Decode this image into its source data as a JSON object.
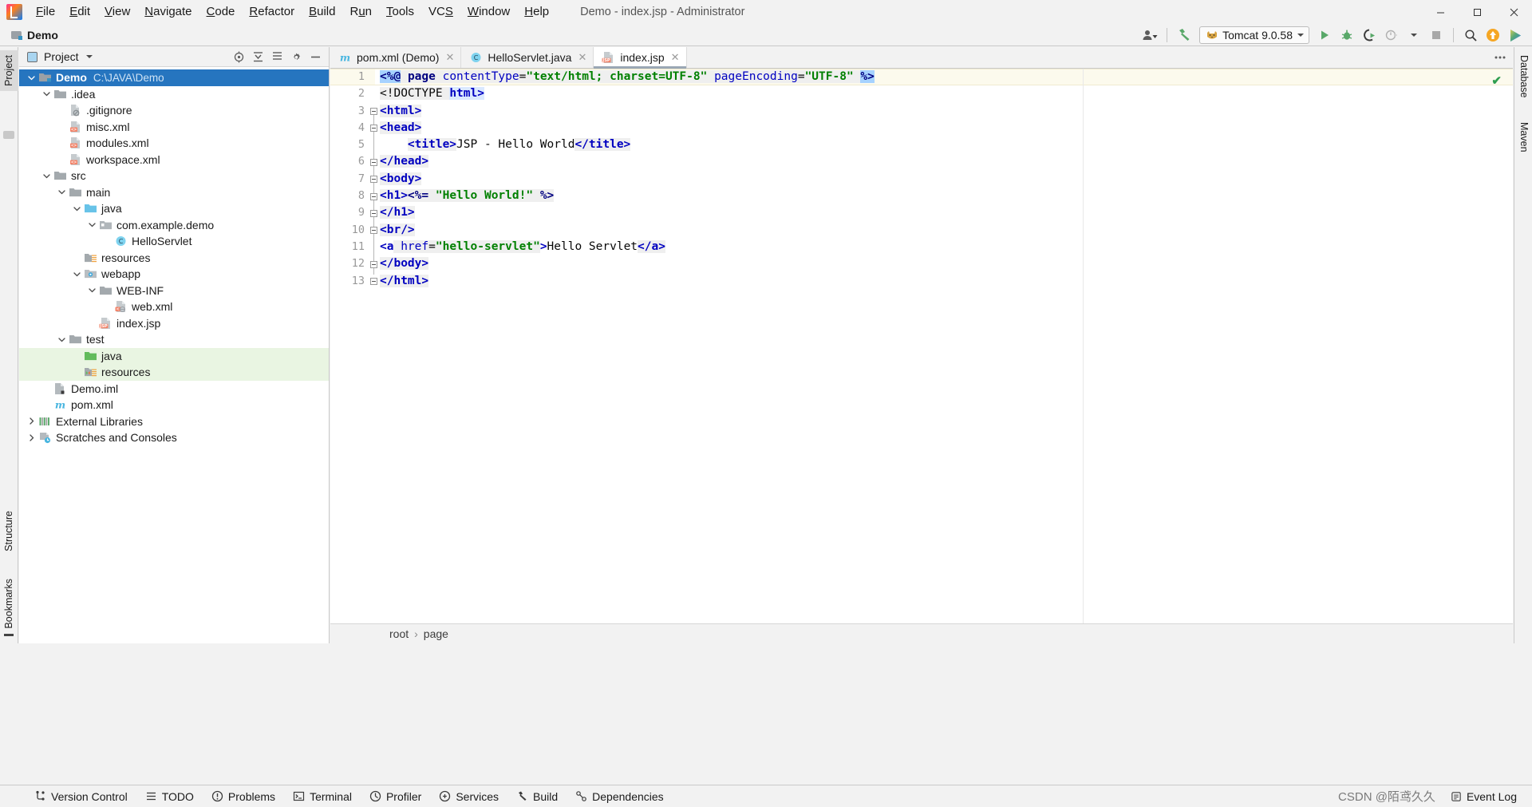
{
  "window": {
    "title": "Demo - index.jsp - Administrator",
    "app_icon": "intellij-idea-logo",
    "controls": {
      "minimize": "─",
      "maximize": "☐",
      "close": "✕"
    }
  },
  "menu": {
    "items": [
      {
        "label": "File",
        "mnemonic": "F"
      },
      {
        "label": "Edit",
        "mnemonic": "E"
      },
      {
        "label": "View",
        "mnemonic": "V"
      },
      {
        "label": "Navigate",
        "mnemonic": "N"
      },
      {
        "label": "Code",
        "mnemonic": "C"
      },
      {
        "label": "Refactor",
        "mnemonic": "R"
      },
      {
        "label": "Build",
        "mnemonic": "B"
      },
      {
        "label": "Run",
        "mnemonic": "u"
      },
      {
        "label": "Tools",
        "mnemonic": "T"
      },
      {
        "label": "VCS",
        "mnemonic": "S"
      },
      {
        "label": "Window",
        "mnemonic": "W"
      },
      {
        "label": "Help",
        "mnemonic": "H"
      }
    ]
  },
  "toolbar": {
    "breadcrumb_project": "Demo",
    "run_config": "Tomcat 9.0.58",
    "run_config_icon": "tomcat-cat-icon",
    "icons": {
      "user": "user-silhouette-icon",
      "hammer": "build-hammer-icon",
      "run": "run-play-icon",
      "debug": "debug-bug-icon",
      "run_coverage": "run-with-coverage-icon",
      "profile": "profiler-icon",
      "stop": "stop-square-icon",
      "search": "search-magnifier-icon",
      "updates": "update-arrow-icon",
      "ide_feature": "ide-feature-trainer-icon"
    }
  },
  "left_strip": {
    "tabs": [
      {
        "label": "Project",
        "active": true
      },
      {
        "label": "Structure",
        "active": false
      },
      {
        "label": "Bookmarks",
        "active": false
      }
    ]
  },
  "right_strip": {
    "tabs": [
      {
        "label": "Database",
        "active": false
      },
      {
        "label": "Maven",
        "active": false
      }
    ]
  },
  "project_panel": {
    "title": "Project",
    "header_icons": [
      "locate-icon",
      "collapse-all-icon",
      "expand-all-icon",
      "settings-gear-icon",
      "hide-minus-icon"
    ],
    "tree": [
      {
        "label": "Demo",
        "path": "C:\\JAVA\\Demo",
        "indent": 0,
        "arrow": "down",
        "icon": "module-folder-icon",
        "state": "selected",
        "bold": true
      },
      {
        "label": ".idea",
        "path": "",
        "indent": 1,
        "arrow": "down",
        "icon": "folder-icon",
        "state": "normal"
      },
      {
        "label": ".gitignore",
        "path": "",
        "indent": 2,
        "arrow": "none",
        "icon": "gitignore-file-icon",
        "state": "normal"
      },
      {
        "label": "misc.xml",
        "path": "",
        "indent": 2,
        "arrow": "none",
        "icon": "xml-file-icon",
        "state": "normal"
      },
      {
        "label": "modules.xml",
        "path": "",
        "indent": 2,
        "arrow": "none",
        "icon": "xml-file-icon",
        "state": "normal"
      },
      {
        "label": "workspace.xml",
        "path": "",
        "indent": 2,
        "arrow": "none",
        "icon": "xml-file-icon",
        "state": "normal"
      },
      {
        "label": "src",
        "path": "",
        "indent": 1,
        "arrow": "down",
        "icon": "folder-icon",
        "state": "normal"
      },
      {
        "label": "main",
        "path": "",
        "indent": 2,
        "arrow": "down",
        "icon": "folder-icon",
        "state": "normal"
      },
      {
        "label": "java",
        "path": "",
        "indent": 3,
        "arrow": "down",
        "icon": "source-root-icon",
        "state": "normal"
      },
      {
        "label": "com.example.demo",
        "path": "",
        "indent": 4,
        "arrow": "down",
        "icon": "package-icon",
        "state": "normal"
      },
      {
        "label": "HelloServlet",
        "path": "",
        "indent": 5,
        "arrow": "none",
        "icon": "java-class-icon",
        "state": "normal"
      },
      {
        "label": "resources",
        "path": "",
        "indent": 3,
        "arrow": "none",
        "icon": "resource-root-icon",
        "state": "normal"
      },
      {
        "label": "webapp",
        "path": "",
        "indent": 3,
        "arrow": "down",
        "icon": "web-root-icon",
        "state": "normal"
      },
      {
        "label": "WEB-INF",
        "path": "",
        "indent": 4,
        "arrow": "down",
        "icon": "folder-icon",
        "state": "normal"
      },
      {
        "label": "web.xml",
        "path": "",
        "indent": 5,
        "arrow": "none",
        "icon": "web-xml-file-icon",
        "state": "normal"
      },
      {
        "label": "index.jsp",
        "path": "",
        "indent": 4,
        "arrow": "none",
        "icon": "jsp-file-icon",
        "state": "normal"
      },
      {
        "label": "test",
        "path": "",
        "indent": 2,
        "arrow": "down",
        "icon": "folder-icon",
        "state": "normal"
      },
      {
        "label": "java",
        "path": "",
        "indent": 3,
        "arrow": "none",
        "icon": "test-source-root-icon",
        "state": "green"
      },
      {
        "label": "resources",
        "path": "",
        "indent": 3,
        "arrow": "none",
        "icon": "test-resource-root-icon",
        "state": "green"
      },
      {
        "label": "Demo.iml",
        "path": "",
        "indent": 1,
        "arrow": "none",
        "icon": "iml-file-icon",
        "state": "normal"
      },
      {
        "label": "pom.xml",
        "path": "",
        "indent": 1,
        "arrow": "none",
        "icon": "maven-pom-icon",
        "state": "normal"
      },
      {
        "label": "External Libraries",
        "path": "",
        "indent": 0,
        "arrow": "right",
        "icon": "libraries-icon",
        "state": "normal"
      },
      {
        "label": "Scratches and Consoles",
        "path": "",
        "indent": 0,
        "arrow": "right",
        "icon": "scratches-icon",
        "state": "normal"
      }
    ]
  },
  "editor": {
    "tabs": [
      {
        "label": "pom.xml (Demo)",
        "icon": "maven-pom-icon",
        "active": false,
        "close": "✕"
      },
      {
        "label": "HelloServlet.java",
        "icon": "java-class-icon",
        "active": false,
        "close": "✕"
      },
      {
        "label": "index.jsp",
        "icon": "jsp-file-icon",
        "active": true,
        "close": "✕"
      }
    ],
    "inspection_status": "✔",
    "gear_icon": "editor-settings-gear-icon",
    "line_numbers": [
      "1",
      "2",
      "3",
      "4",
      "5",
      "6",
      "7",
      "8",
      "9",
      "10",
      "11",
      "12",
      "13"
    ],
    "current_line": 1,
    "lines": [
      {
        "n": 1,
        "parts": [
          {
            "t": "<%@",
            "c": "sel"
          },
          {
            "t": " ",
            "c": "soft"
          },
          {
            "t": "page",
            "c": "kw"
          },
          {
            "t": " ",
            "c": "soft"
          },
          {
            "t": "contentType",
            "c": "attr"
          },
          {
            "t": "=",
            "c": "soft"
          },
          {
            "t": "\"text/html; charset=UTF-8\"",
            "c": "str"
          },
          {
            "t": " ",
            "c": "soft"
          },
          {
            "t": "pageEncoding",
            "c": "attr"
          },
          {
            "t": "=",
            "c": "soft"
          },
          {
            "t": "\"UTF-8\"",
            "c": "str"
          },
          {
            "t": " ",
            "c": "soft"
          },
          {
            "t": "%>",
            "c": "sel"
          }
        ]
      },
      {
        "n": 2,
        "parts": [
          {
            "t": "<!DOCTYPE",
            "c": "doctype"
          },
          {
            "t": " ",
            "c": "soft"
          },
          {
            "t": "html>",
            "c": "htmlkw"
          }
        ]
      },
      {
        "n": 3,
        "parts": [
          {
            "t": "<html>",
            "c": "tagsoft"
          }
        ]
      },
      {
        "n": 4,
        "parts": [
          {
            "t": "<head>",
            "c": "tagsoft"
          }
        ]
      },
      {
        "n": 5,
        "parts": [
          {
            "t": "    ",
            "c": "plain"
          },
          {
            "t": "<title>",
            "c": "tagsoft"
          },
          {
            "t": "JSP - Hello World",
            "c": "plain"
          },
          {
            "t": "</title>",
            "c": "tagsoft"
          }
        ]
      },
      {
        "n": 6,
        "parts": [
          {
            "t": "</head>",
            "c": "tagsoft"
          }
        ]
      },
      {
        "n": 7,
        "parts": [
          {
            "t": "<body>",
            "c": "tagsoft"
          }
        ]
      },
      {
        "n": 8,
        "parts": [
          {
            "t": "<h1>",
            "c": "tagsoft"
          },
          {
            "t": "<%=",
            "c": "kwsoft"
          },
          {
            "t": " ",
            "c": "soft"
          },
          {
            "t": "\"Hello World!\"",
            "c": "str"
          },
          {
            "t": " ",
            "c": "soft"
          },
          {
            "t": "%>",
            "c": "kwsoft"
          }
        ]
      },
      {
        "n": 9,
        "parts": [
          {
            "t": "</h1>",
            "c": "tagsoft"
          }
        ]
      },
      {
        "n": 10,
        "parts": [
          {
            "t": "<br/>",
            "c": "tagsoft"
          }
        ]
      },
      {
        "n": 11,
        "parts": [
          {
            "t": "<a",
            "c": "tag"
          },
          {
            "t": " ",
            "c": "soft"
          },
          {
            "t": "href",
            "c": "attr"
          },
          {
            "t": "=",
            "c": "soft"
          },
          {
            "t": "\"hello-servlet\"",
            "c": "str"
          },
          {
            "t": ">",
            "c": "tag"
          },
          {
            "t": "Hello Servlet",
            "c": "plain"
          },
          {
            "t": "</a>",
            "c": "tagsoft"
          }
        ]
      },
      {
        "n": 12,
        "parts": [
          {
            "t": "</body>",
            "c": "tagsoft"
          }
        ]
      },
      {
        "n": 13,
        "parts": [
          {
            "t": "</html>",
            "c": "tagsoft"
          }
        ]
      }
    ],
    "breadcrumbs": [
      "root",
      "page"
    ],
    "breadcrumb_separator": "›"
  },
  "status_bar": {
    "items": [
      {
        "label": "Version Control",
        "icon": "version-control-icon"
      },
      {
        "label": "TODO",
        "icon": "todo-list-icon"
      },
      {
        "label": "Problems",
        "icon": "problems-warning-icon"
      },
      {
        "label": "Terminal",
        "icon": "terminal-icon"
      },
      {
        "label": "Profiler",
        "icon": "profiler-icon"
      },
      {
        "label": "Services",
        "icon": "services-icon"
      },
      {
        "label": "Build",
        "icon": "build-hammer-icon"
      },
      {
        "label": "Dependencies",
        "icon": "dependencies-icon"
      }
    ],
    "event_log": {
      "label": "Event Log",
      "icon": "event-log-icon"
    },
    "watermark": "CSDN @陌鸢久久"
  },
  "colors": {
    "accent_blue": "#2675bf",
    "selection_blue": "#a6d2ff",
    "tomcat_green": "#59a869",
    "test_green_bg": "#e9f5e2",
    "xml_orange": "#f2846a",
    "current_line": "#fcfaed",
    "string_green": "#008000",
    "tag_blue": "#0000c0"
  }
}
